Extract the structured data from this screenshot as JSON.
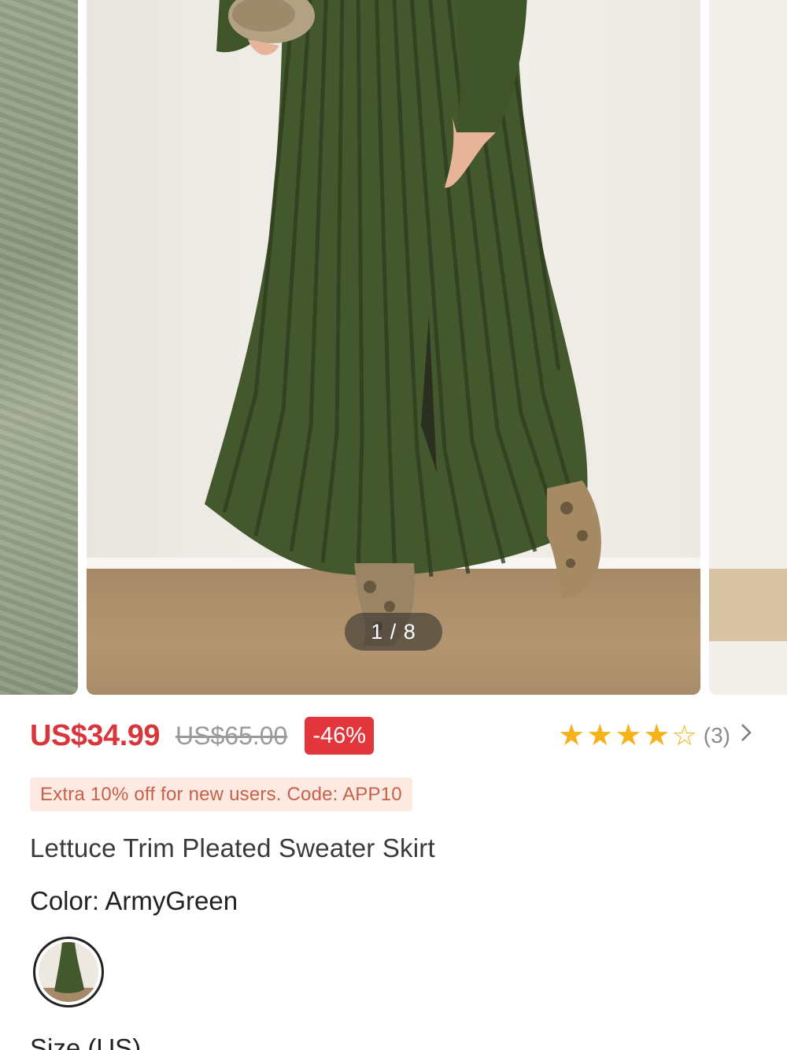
{
  "carousel": {
    "indicator": "1 / 8",
    "alt_main": "Lettuce Trim Pleated Sweater Skirt",
    "colors": {
      "skirt": "#44582e",
      "wall": "#efece5",
      "floor": "#a68a67"
    }
  },
  "price": {
    "current": "US$34.99",
    "original": "US$65.00",
    "discount": "-46%",
    "accent": "#d8363b"
  },
  "rating": {
    "stars_filled": 4,
    "stars_total": 5,
    "count": "(3)",
    "star_color": "#f6b21a"
  },
  "promo": {
    "text": "Extra 10% off for new users. Code: APP10"
  },
  "product": {
    "title": "Lettuce Trim Pleated Sweater Skirt"
  },
  "color": {
    "label": "Color: ArmyGreen"
  },
  "size": {
    "label": "Size (US)"
  },
  "icons": {
    "star": "star-icon",
    "star_outline": "star-outline-icon",
    "chevron": "chevron-right-icon"
  }
}
